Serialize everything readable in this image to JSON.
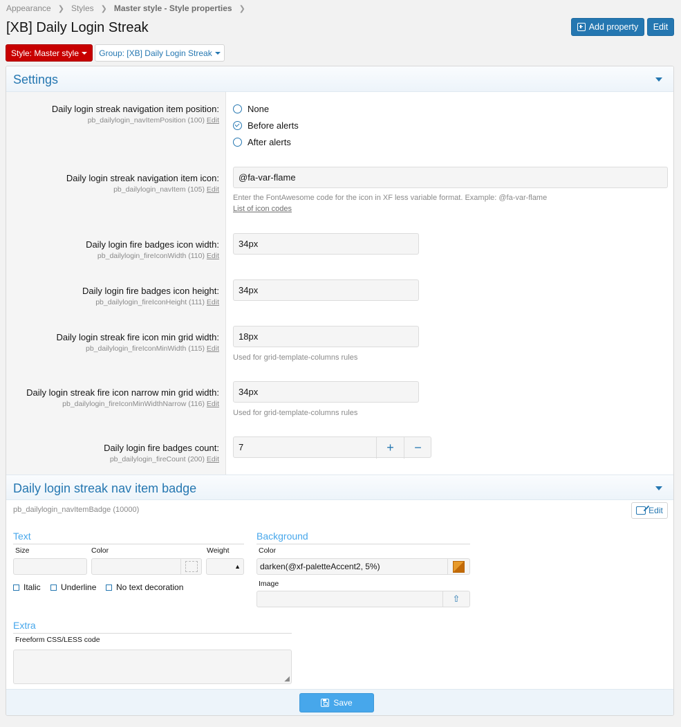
{
  "breadcrumb": [
    "Appearance",
    "Styles",
    "Master style - Style properties"
  ],
  "page_title": "[XB] Daily Login Streak",
  "toolbar": {
    "add_label": "Add property",
    "edit_label": "Edit"
  },
  "filters": {
    "style_label": "Style: Master style",
    "group_label": "Group: [XB] Daily Login Streak"
  },
  "settings": {
    "title": "Settings",
    "nav_position": {
      "label": "Daily login streak navigation item position:",
      "name": "pb_dailylogin_navItemPosition (100)",
      "options": [
        "None",
        "Before alerts",
        "After alerts"
      ],
      "selected": "Before alerts"
    },
    "nav_icon": {
      "label": "Daily login streak navigation item icon:",
      "name": "pb_dailylogin_navItem (105)",
      "value": "@fa-var-flame",
      "hint": "Enter the FontAwesome code for the icon in XF less variable format. Example: @fa-var-flame",
      "link": "List of icon codes"
    },
    "fire_width": {
      "label": "Daily login fire badges icon width:",
      "name": "pb_dailylogin_fireIconWidth (110)",
      "value": "34px"
    },
    "fire_height": {
      "label": "Daily login fire badges icon height:",
      "name": "pb_dailylogin_fireIconHeight (111)",
      "value": "34px"
    },
    "min_grid": {
      "label": "Daily login streak fire icon min grid width:",
      "name": "pb_dailylogin_fireIconMinWidth (115)",
      "value": "18px",
      "hint": "Used for grid-template-columns rules"
    },
    "narrow_grid": {
      "label": "Daily login streak fire icon narrow min grid width:",
      "name": "pb_dailylogin_fireIconMinWidthNarrow (116)",
      "value": "34px",
      "hint": "Used for grid-template-columns rules"
    },
    "fire_count": {
      "label": "Daily login fire badges count:",
      "name": "pb_dailylogin_fireCount (200)",
      "value": "7",
      "plus": "+",
      "minus": "−"
    },
    "edit_link": "Edit"
  },
  "badge": {
    "title": "Daily login streak nav item badge",
    "name": "pb_dailylogin_navItemBadge (10000)",
    "edit_label": "Edit",
    "text_group": {
      "title": "Text",
      "size_label": "Size",
      "color_label": "Color",
      "weight_label": "Weight",
      "italic": "Italic",
      "underline": "Underline",
      "no_decoration": "No text decoration"
    },
    "background_group": {
      "title": "Background",
      "color_label": "Color",
      "color_value": "darken(@xf-paletteAccent2, 5%)",
      "swatch": "#d27a11",
      "image_label": "Image"
    },
    "extra_group": {
      "title": "Extra",
      "code_label": "Freeform CSS/LESS code"
    }
  },
  "footer": {
    "save_label": "Save"
  }
}
